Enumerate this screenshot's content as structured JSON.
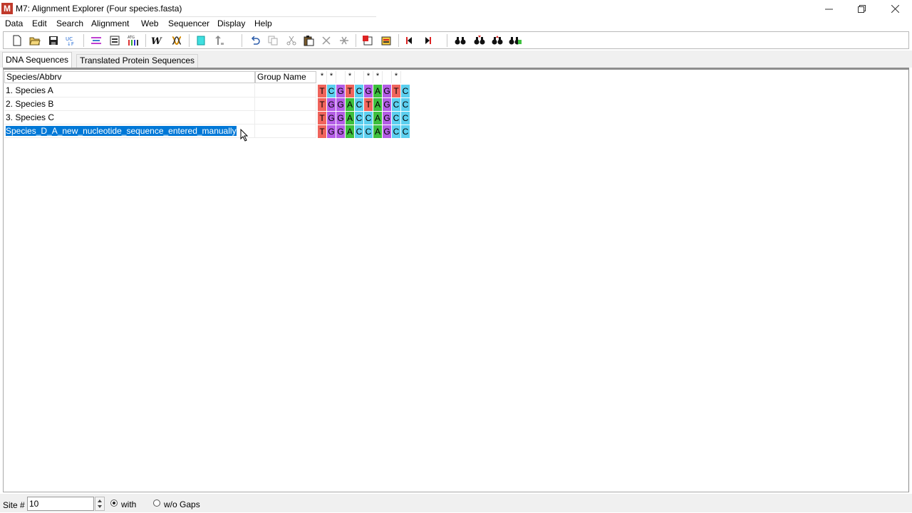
{
  "window": {
    "title": "M7: Alignment Explorer (Four species.fasta)",
    "app_icon_letter": "M"
  },
  "menu": [
    "Data",
    "Edit",
    "Search",
    "Alignment",
    "Web",
    "Sequencer",
    "Display",
    "Help"
  ],
  "toolbar_icons": [
    "new-file-icon",
    "open-folder-icon",
    "save-icon",
    "edit-sequence-icon",
    "align-clustal-icon",
    "align-muscle-icon",
    "sequence-data-icon",
    "web-icon",
    "sequencer-icon",
    "highlight-icon",
    "sort-icon",
    "undo-icon",
    "copy-icon",
    "cut-icon",
    "paste-icon",
    "delete-icon",
    "delete-gap-icon",
    "add-sequence-icon",
    "import-sequence-icon",
    "previous-icon",
    "next-icon",
    "find-icon",
    "find-next-icon",
    "find-previous-icon",
    "find-motif-icon"
  ],
  "tabs": {
    "dna": "DNA Sequences",
    "protein": "Translated Protein Sequences"
  },
  "grid": {
    "headers": {
      "species": "Species/Abbrv",
      "group": "Group Name"
    },
    "conservation": [
      "*",
      "*",
      "",
      "*",
      "",
      "*",
      "*",
      "",
      "*"
    ],
    "rows": [
      {
        "name": "1. Species A",
        "group": "",
        "sequence": [
          "T",
          "C",
          "G",
          "T",
          "C",
          "G",
          "A",
          "G",
          "T",
          "C"
        ]
      },
      {
        "name": "2. Species B",
        "group": "",
        "sequence": [
          "T",
          "G",
          "G",
          "A",
          "C",
          "T",
          "A",
          "G",
          "C",
          "C"
        ]
      },
      {
        "name": "3. Species C",
        "group": "",
        "sequence": [
          "T",
          "G",
          "G",
          "A",
          "C",
          "C",
          "A",
          "G",
          "C",
          "C"
        ]
      },
      {
        "name": "Species_D_A_new_nucleotide_sequence_entered_manually",
        "group": "",
        "sequence": [
          "T",
          "G",
          "G",
          "A",
          "C",
          "C",
          "A",
          "G",
          "C",
          "C"
        ],
        "selected": true
      }
    ]
  },
  "base_colors": {
    "A": "#3dbf3d",
    "C": "#5ccfef",
    "G": "#b45ee6",
    "T": "#f0645c"
  },
  "status": {
    "site_label": "Site #",
    "site_value": "10",
    "with_label": "with",
    "without_label": "w/o Gaps"
  }
}
